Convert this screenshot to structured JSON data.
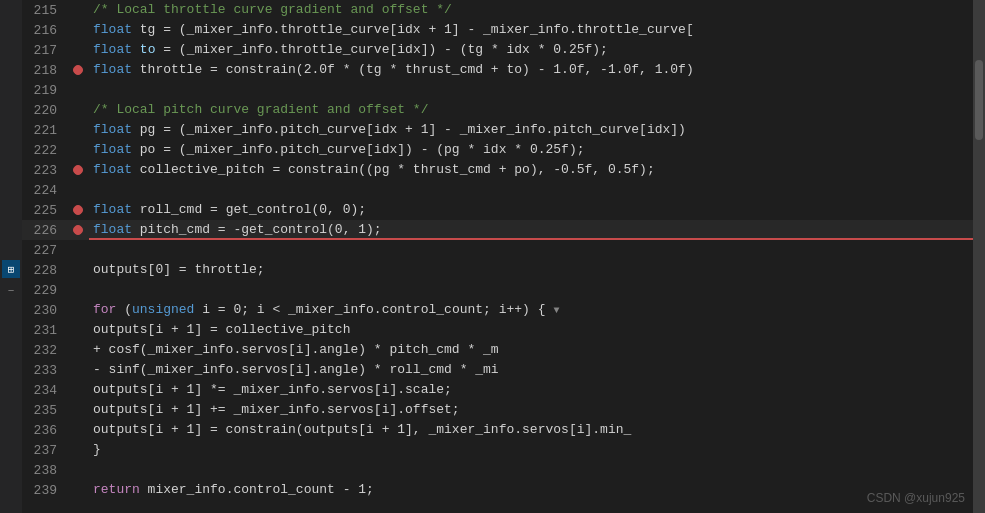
{
  "editor": {
    "lines": [
      {
        "num": 215,
        "bp": false,
        "active": false,
        "content": [
          {
            "t": "cm",
            "v": "/* Local throttle curve gradient and offset */"
          }
        ]
      },
      {
        "num": 216,
        "bp": false,
        "active": false,
        "content": [
          {
            "t": "plain",
            "v": "    "
          },
          {
            "t": "kw",
            "v": "float"
          },
          {
            "t": "plain",
            "v": " tg = (_mixer_info.throttle_curve[idx + 1] - _mixer_info.throttle_curve["
          }
        ]
      },
      {
        "num": 217,
        "bp": false,
        "active": false,
        "content": [
          {
            "t": "plain",
            "v": "    "
          },
          {
            "t": "kw",
            "v": "float"
          },
          {
            "t": "plain",
            "v": " "
          },
          {
            "t": "var",
            "v": "to"
          },
          {
            "t": "plain",
            "v": " = (_mixer_info.throttle_curve[idx]) - (tg * idx * 0.25f);"
          }
        ]
      },
      {
        "num": 218,
        "bp": true,
        "active": false,
        "content": [
          {
            "t": "plain",
            "v": "    "
          },
          {
            "t": "kw",
            "v": "float"
          },
          {
            "t": "plain",
            "v": " throttle = constrain(2.0f * (tg * thrust_cmd + to) - 1.0f, -1.0f, 1.0f)"
          }
        ]
      },
      {
        "num": 219,
        "bp": false,
        "active": false,
        "content": []
      },
      {
        "num": 220,
        "bp": false,
        "active": false,
        "content": [
          {
            "t": "plain",
            "v": "    "
          },
          {
            "t": "cm",
            "v": "/* Local "
          },
          {
            "t": "cm-pitch",
            "v": "pitch"
          },
          {
            "t": "cm",
            "v": " curve gradient and offset */"
          }
        ]
      },
      {
        "num": 221,
        "bp": false,
        "active": false,
        "content": [
          {
            "t": "plain",
            "v": "    "
          },
          {
            "t": "kw",
            "v": "float"
          },
          {
            "t": "plain",
            "v": " pg = (_mixer_info.pitch_curve[idx + 1] - _mixer_info.pitch_curve[idx])"
          }
        ]
      },
      {
        "num": 222,
        "bp": false,
        "active": false,
        "content": [
          {
            "t": "plain",
            "v": "    "
          },
          {
            "t": "kw",
            "v": "float"
          },
          {
            "t": "plain",
            "v": " po = (_mixer_info.pitch_curve[idx]) - (pg * idx * 0.25f);"
          }
        ]
      },
      {
        "num": 223,
        "bp": true,
        "active": false,
        "content": [
          {
            "t": "plain",
            "v": "    "
          },
          {
            "t": "kw",
            "v": "float"
          },
          {
            "t": "plain",
            "v": " collective_pitch = constrain((pg * thrust_cmd + po), -0.5f, 0.5f);"
          }
        ]
      },
      {
        "num": 224,
        "bp": false,
        "active": false,
        "content": []
      },
      {
        "num": 225,
        "bp": true,
        "active": false,
        "content": [
          {
            "t": "plain",
            "v": "    "
          },
          {
            "t": "kw",
            "v": "float"
          },
          {
            "t": "plain",
            "v": " roll_cmd = get_control(0, 0);"
          }
        ]
      },
      {
        "num": 226,
        "bp": true,
        "active": true,
        "redline": true,
        "content": [
          {
            "t": "plain",
            "v": "    "
          },
          {
            "t": "kw",
            "v": "float"
          },
          {
            "t": "plain",
            "v": " pitch_cmd = -get_control(0, 1);"
          }
        ]
      },
      {
        "num": 227,
        "bp": false,
        "active": false,
        "content": []
      },
      {
        "num": 228,
        "bp": false,
        "active": false,
        "content": [
          {
            "t": "plain",
            "v": "    outputs[0] = throttle;"
          }
        ]
      },
      {
        "num": 229,
        "bp": false,
        "active": false,
        "content": []
      },
      {
        "num": 230,
        "bp": false,
        "active": false,
        "fold": true,
        "content": [
          {
            "t": "plain",
            "v": "    "
          },
          {
            "t": "kw2",
            "v": "for"
          },
          {
            "t": "plain",
            "v": " ("
          },
          {
            "t": "kw",
            "v": "unsigned"
          },
          {
            "t": "plain",
            "v": " i = 0; i < _mixer_info.control_count; i++) {"
          }
        ]
      },
      {
        "num": 231,
        "bp": false,
        "active": false,
        "content": [
          {
            "t": "plain",
            "v": "        outputs[i + 1] = collective_pitch"
          }
        ]
      },
      {
        "num": 232,
        "bp": false,
        "active": false,
        "content": [
          {
            "t": "plain",
            "v": "                            + cosf(_mixer_info.servos[i].angle) * pitch_cmd * _m"
          }
        ]
      },
      {
        "num": 233,
        "bp": false,
        "active": false,
        "content": [
          {
            "t": "plain",
            "v": "                            - sinf(_mixer_info.servos[i].angle) * roll_cmd * _mi"
          }
        ]
      },
      {
        "num": 234,
        "bp": false,
        "active": false,
        "content": [
          {
            "t": "plain",
            "v": "        outputs[i + 1] *= _mixer_info.servos[i].scale;"
          }
        ]
      },
      {
        "num": 235,
        "bp": false,
        "active": false,
        "content": [
          {
            "t": "plain",
            "v": "        outputs[i + 1] += _mixer_info.servos[i].offset;"
          }
        ]
      },
      {
        "num": 236,
        "bp": false,
        "active": false,
        "content": [
          {
            "t": "plain",
            "v": "        outputs[i + 1] = constrain(outputs[i + 1], _mixer_info.servos[i].min_"
          }
        ]
      },
      {
        "num": 237,
        "bp": false,
        "active": false,
        "content": [
          {
            "t": "plain",
            "v": "    }"
          }
        ]
      },
      {
        "num": 238,
        "bp": false,
        "active": false,
        "content": []
      },
      {
        "num": 239,
        "bp": false,
        "active": false,
        "content": [
          {
            "t": "plain",
            "v": "    "
          },
          {
            "t": "kw2",
            "v": "return"
          },
          {
            "t": "plain",
            "v": "  mixer_info.control_count - 1;"
          }
        ]
      }
    ]
  },
  "sidebar": {
    "icons": [
      {
        "name": "grid-icon",
        "label": "⊞",
        "active": true
      },
      {
        "name": "minus-icon",
        "label": "−",
        "active": false
      }
    ]
  },
  "watermark": {
    "text": "CSDN @xujun925"
  }
}
